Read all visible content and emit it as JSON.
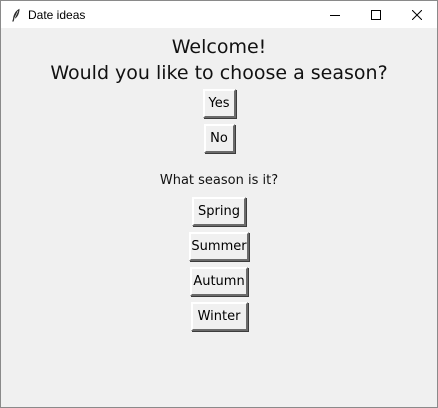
{
  "window": {
    "title": "Date ideas",
    "icon": "feather-icon",
    "controls": {
      "minimize": "minimize-icon",
      "maximize": "maximize-icon",
      "close": "close-icon"
    }
  },
  "main": {
    "welcome": "Welcome!",
    "question": "Would you like to choose a season?",
    "yes_label": "Yes",
    "no_label": "No",
    "season_question": "What season is it?",
    "seasons": [
      "Spring",
      "Summer",
      "Autumn",
      "Winter"
    ]
  }
}
